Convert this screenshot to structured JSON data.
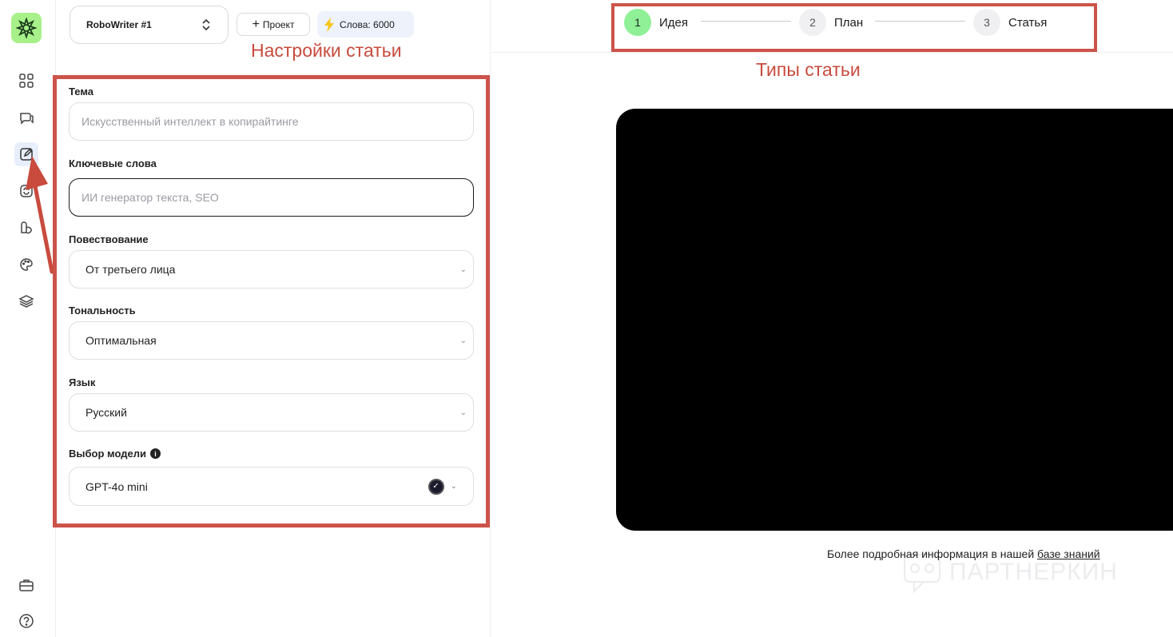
{
  "sidebar": {
    "icons": [
      "grid-icon",
      "chat-icon",
      "edit-icon",
      "refresh-icon",
      "leaf-icon",
      "palette-icon",
      "layers-icon",
      "briefcase-icon",
      "help-icon"
    ]
  },
  "header": {
    "project_name": "RoboWriter #1",
    "add_project_label": "Проект",
    "words_label": "Слова: 6000"
  },
  "annotations": {
    "settings": "Настройки статьи",
    "types": "Типы статьи"
  },
  "form": {
    "topic_label": "Тема",
    "topic_placeholder": "Искусственный интеллект в копирайтинге",
    "keywords_label": "Ключевые слова",
    "keywords_placeholder": "ИИ генератор текста, SEO",
    "narration_label": "Повествование",
    "narration_value": "От третьего лица",
    "tone_label": "Тональность",
    "tone_value": "Оптимальная",
    "language_label": "Язык",
    "language_value": "Русский",
    "model_label": "Выбор модели",
    "model_value": "GPT-4o mini"
  },
  "stepper": {
    "steps": [
      {
        "num": "1",
        "label": "Идея"
      },
      {
        "num": "2",
        "label": "План"
      },
      {
        "num": "3",
        "label": "Статья"
      }
    ]
  },
  "footer": {
    "kb_text": "Более подробная информация в нашей ",
    "kb_link": "базе знаний",
    "watermark": "ПАРТНЕРКИН"
  }
}
